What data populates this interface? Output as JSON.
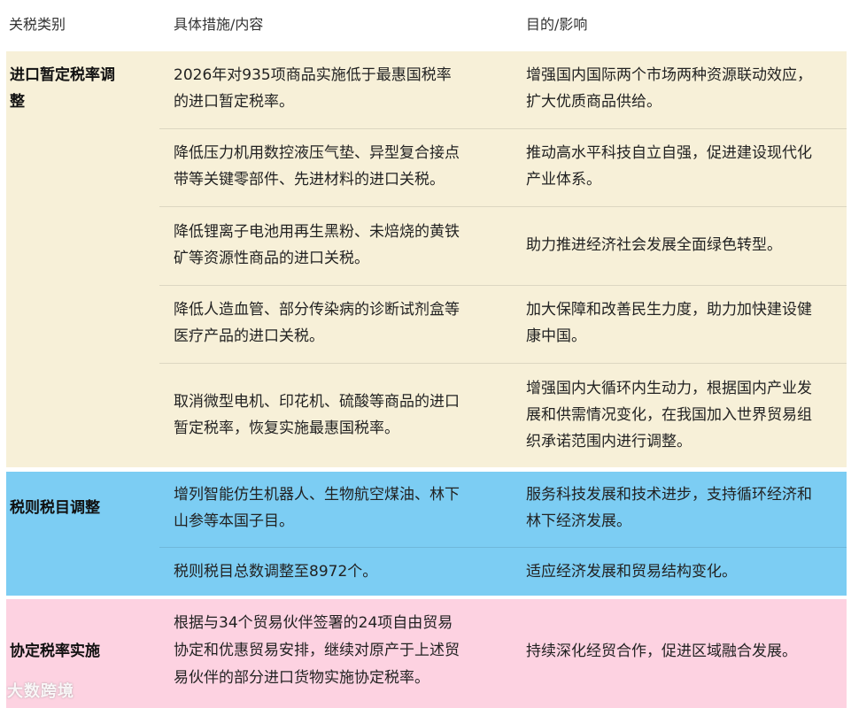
{
  "header": {
    "col_category": "关税类别",
    "col_measure": "具体措施/内容",
    "col_effect": "目的/影响"
  },
  "sections": [
    {
      "category_lines": [
        "进口暂定税率调",
        "整"
      ],
      "color": "#f7f0d8",
      "rows": [
        {
          "measure": [
            "2026年对935项商品实施低于最惠国税率",
            "的进口暂定税率。"
          ],
          "effect": [
            "增强国内国际两个市场两种资源联动效应，",
            "扩大优质商品供给。"
          ]
        },
        {
          "measure": [
            "降低压力机用数控液压气垫、异型复合接点",
            "带等关键零部件、先进材料的进口关税。"
          ],
          "effect": [
            "推动高水平科技自立自强，促进建设现代化",
            "产业体系。"
          ]
        },
        {
          "measure": [
            "降低锂离子电池用再生黑粉、未焙烧的黄铁",
            "矿等资源性商品的进口关税。"
          ],
          "effect": [
            "助力推进经济社会发展全面绿色转型。"
          ]
        },
        {
          "measure": [
            "降低人造血管、部分传染病的诊断试剂盒等",
            "医疗产品的进口关税。"
          ],
          "effect": [
            "加大保障和改善民生力度，助力加快建设健",
            "康中国。"
          ]
        },
        {
          "measure": [
            "取消微型电机、印花机、硫酸等商品的进口",
            "暂定税率，恢复实施最惠国税率。"
          ],
          "effect": [
            "增强国内大循环内生动力，根据国内产业发",
            "展和供需情况变化，在我国加入世界贸易组",
            "织承诺范围内进行调整。"
          ]
        }
      ]
    },
    {
      "category_lines": [
        "税则税目调整"
      ],
      "color": "#7ccdf3",
      "rows": [
        {
          "measure": [
            "增列智能仿生机器人、生物航空煤油、林下",
            "山参等本国子目。"
          ],
          "effect": [
            "服务科技发展和技术进步，支持循环经济和",
            "林下经济发展。"
          ]
        },
        {
          "measure": [
            "税则税目总数调整至8972个。"
          ],
          "effect": [
            "适应经济发展和贸易结构变化。"
          ]
        }
      ]
    },
    {
      "category_lines": [
        "协定税率实施"
      ],
      "color": "#fdd2e1",
      "rows": [
        {
          "measure": [
            "根据与34个贸易伙伴签署的24项自由贸易",
            "协定和优惠贸易安排，继续对原产于上述贸",
            "易伙伴的部分进口货物实施协定税率。"
          ],
          "effect": [
            "持续深化经贸合作，促进区域融合发展。"
          ]
        }
      ]
    }
  ],
  "watermark": "大数跨境"
}
